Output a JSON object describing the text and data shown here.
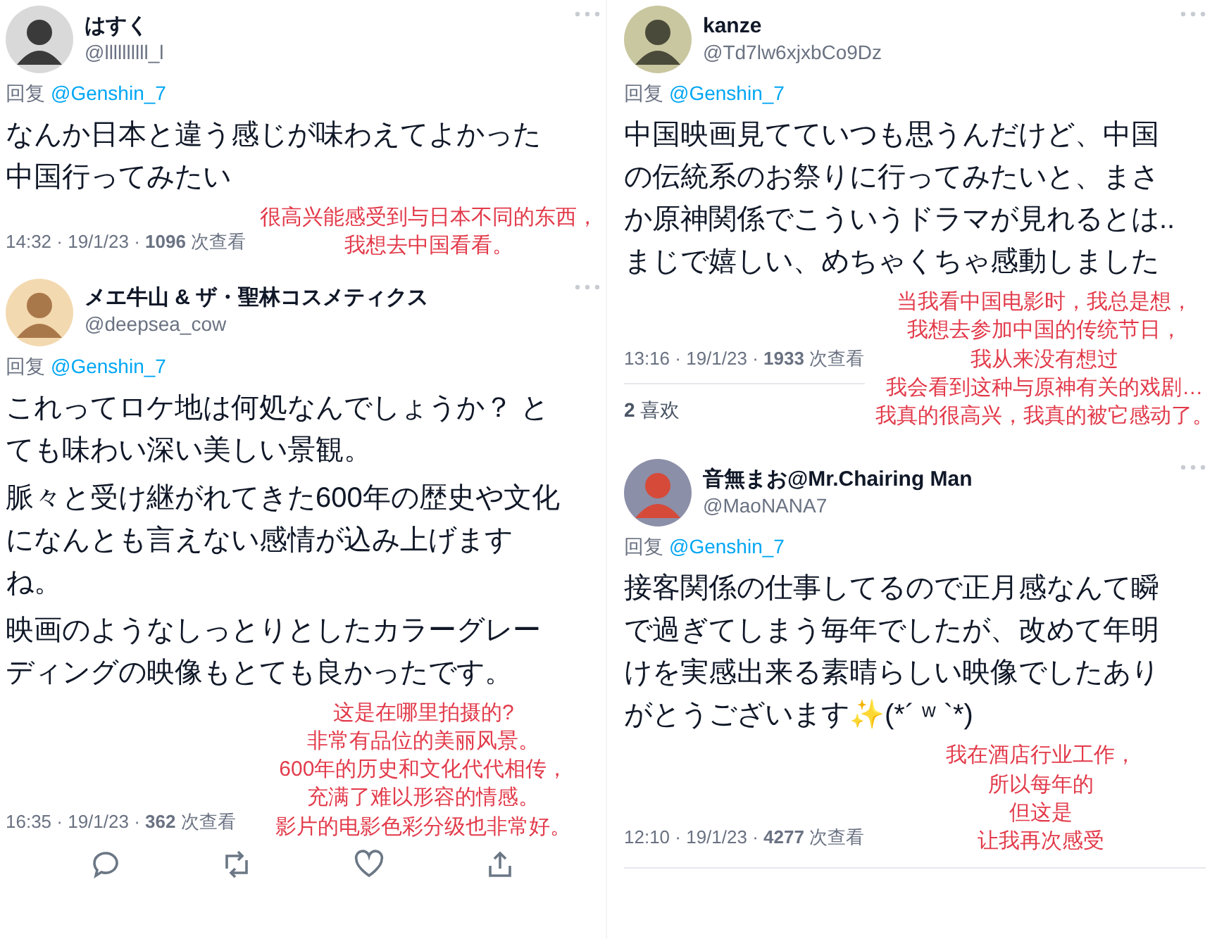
{
  "columns": [
    {
      "tweets": [
        {
          "name": "はすく",
          "handle": "@llllllllll_l",
          "more": true,
          "reply_label": "回复",
          "reply_to": "@Genshin_7",
          "paragraphs": [
            "なんか日本と違う感じが味わえてよかった中国行ってみたい"
          ],
          "translation": [
            "很高兴能感受到与日本不同的东西，",
            "我想去中国看看。"
          ],
          "meta": "14:32 · 19/1/23 · **1096** 次查看",
          "show_actions": false
        },
        {
          "name": "メエ牛山 & ザ・聖林コスメティクス",
          "handle": "@deepsea_cow",
          "more": true,
          "reply_label": "回复",
          "reply_to": "@Genshin_7",
          "paragraphs": [
            "これってロケ地は何処なんでしょうか？ とても味わい深い美しい景観。",
            "脈々と受け継がれてきた600年の歴史や文化になんとも言えない感情が込み上げますね。",
            "映画のようなしっとりとしたカラーグレーディングの映像もとても良かったです。"
          ],
          "translation": [
            "这是在哪里拍摄的?",
            "非常有品位的美丽风景。",
            "600年的历史和文化代代相传，",
            "充满了难以形容的情感。",
            "影片的电影色彩分级也非常好。"
          ],
          "meta": "16:35 · 19/1/23 · **362** 次查看",
          "show_actions": true
        }
      ]
    },
    {
      "tweets": [
        {
          "name": "kanze",
          "handle": "@Td7lw6xjxbCo9Dz",
          "more": true,
          "reply_label": "回复",
          "reply_to": "@Genshin_7",
          "paragraphs": [
            "中国映画見てていつも思うんだけど、中国の伝統系のお祭りに行ってみたいと、まさか原神関係でこういうドラマが見れるとは..まじで嬉しい、めちゃくちゃ感動しました"
          ],
          "translation": [
            "当我看中国电影时，我总是想，",
            "我想去参加中国的传统节日，",
            "我从来没有想过",
            "我会看到这种与原神有关的戏剧…",
            "我真的很高兴，我真的被它感动了。"
          ],
          "meta": "13:16 · 19/1/23 · **1933** 次查看",
          "likes": "**2** 喜欢",
          "show_actions": false
        },
        {
          "name": "音無まお@Mr.Chairing Man",
          "handle": "@MaoNANA7",
          "more": true,
          "reply_label": "回复",
          "reply_to": "@Genshin_7",
          "paragraphs": [
            "接客関係の仕事してるので正月感なんて瞬で過ぎてしまう毎年でしたが、改めて年明けを実感出来る素晴らしい映像でしたありがとうございます✨(*´ ʷ `*)"
          ],
          "translation": [
            "我在酒店行业工作，",
            "所以每年的",
            "但这是",
            "让我再次感受"
          ],
          "meta": "12:10 · 19/1/23 · **4277** 次查看",
          "show_actions": false
        }
      ]
    }
  ]
}
